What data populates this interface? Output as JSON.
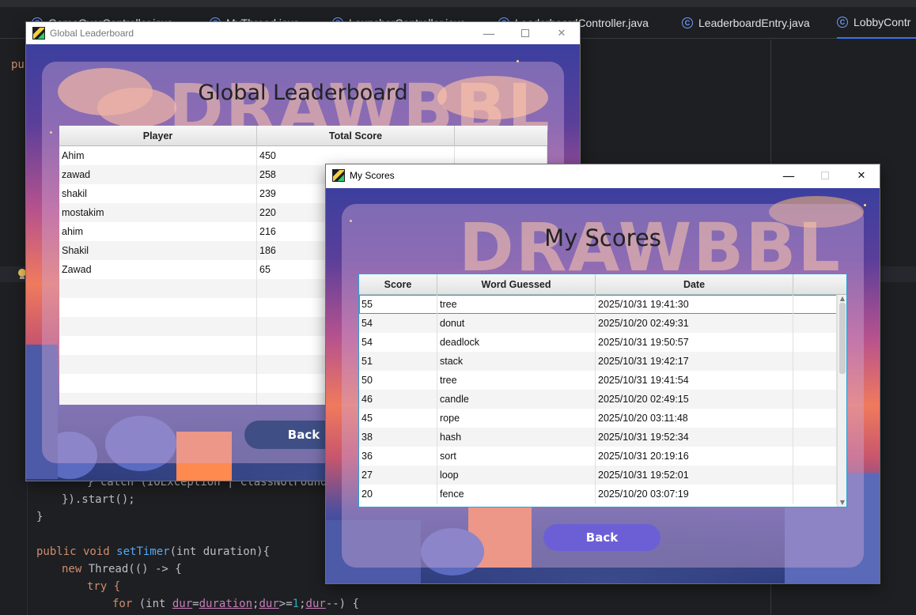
{
  "ide": {
    "tabs": [
      {
        "label": "GameOverController.java"
      },
      {
        "label": "MyThread.java"
      },
      {
        "label": "LauncherController.java"
      },
      {
        "label": "LeaderboardController.java"
      },
      {
        "label": "LeaderboardEntry.java"
      },
      {
        "label": "LobbyContr"
      }
    ],
    "code_lines": {
      "pub": "pub",
      "catch": "} catch (IOException | ClassNotFoundEx",
      "start": "}).start();",
      "close": "}",
      "method_kw": "public void ",
      "method_name": "setTimer",
      "method_rest": "(int duration){",
      "thread_kw": "new ",
      "thread_rest": "Thread(() -> {",
      "try": "try {",
      "for_kw": "for ",
      "for_open": "(int ",
      "for_var1": "dur",
      "for_eq": "=",
      "for_var2": "duration",
      "for_sep": ";",
      "for_var3": "dur",
      "for_cmp": ">=",
      "for_num": "1",
      "for_sep2": ";",
      "for_var4": "dur",
      "for_end": "--) {"
    }
  },
  "leaderboard_window": {
    "title": "Global Leaderboard",
    "watermark": "DRAWBBL",
    "heading": "Global Leaderboard",
    "columns": [
      "Player",
      "Total Score",
      ""
    ],
    "rows": [
      {
        "player": "Ahim",
        "score": "450"
      },
      {
        "player": "zawad",
        "score": "258"
      },
      {
        "player": "shakil",
        "score": "239"
      },
      {
        "player": "mostakim",
        "score": "220"
      },
      {
        "player": "ahim",
        "score": "216"
      },
      {
        "player": "Shakil",
        "score": "186"
      },
      {
        "player": "Zawad",
        "score": "65"
      }
    ],
    "back_label": "Back",
    "close_glyph": "✕",
    "min_glyph": "—"
  },
  "scores_window": {
    "title": "My Scores",
    "watermark": "DRAWBBL",
    "heading": "My Scores",
    "columns": [
      "Score",
      "Word Guessed",
      "Date",
      ""
    ],
    "rows": [
      {
        "score": "55",
        "word": "tree",
        "date": "2025/10/31 19:41:30"
      },
      {
        "score": "54",
        "word": "donut",
        "date": "2025/10/20 02:49:31"
      },
      {
        "score": "54",
        "word": "deadlock",
        "date": "2025/10/31 19:50:57"
      },
      {
        "score": "51",
        "word": "stack",
        "date": "2025/10/31 19:42:17"
      },
      {
        "score": "50",
        "word": "tree",
        "date": "2025/10/31 19:41:54"
      },
      {
        "score": "46",
        "word": "candle",
        "date": "2025/10/20 02:49:15"
      },
      {
        "score": "45",
        "word": "rope",
        "date": "2025/10/20 03:11:48"
      },
      {
        "score": "38",
        "word": "hash",
        "date": "2025/10/31 19:52:34"
      },
      {
        "score": "36",
        "word": "sort",
        "date": "2025/10/31 20:19:16"
      },
      {
        "score": "27",
        "word": "loop",
        "date": "2025/10/31 19:52:01"
      },
      {
        "score": "20",
        "word": "fence",
        "date": "2025/10/20 03:07:19"
      }
    ],
    "back_label": "Back",
    "close_glyph": "✕",
    "min_glyph": "—"
  },
  "colors": {
    "back_button_leaderboard": "#3f4f86",
    "back_button_scores": "#6c5fd6",
    "selection_outline": "#2a9fd6"
  }
}
